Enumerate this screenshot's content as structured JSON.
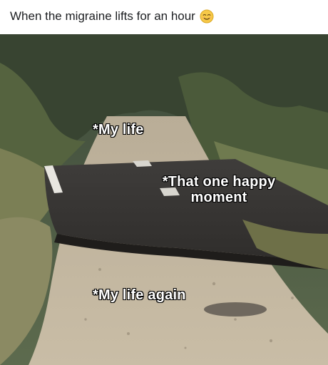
{
  "post": {
    "caption": "When the migraine lifts for an hour",
    "caption_emoji": "relieved-face-emoji"
  },
  "meme": {
    "labels": {
      "my_life": "*My life",
      "happy_moment": "*That one happy moment",
      "my_life_again": "*My life again"
    }
  }
}
